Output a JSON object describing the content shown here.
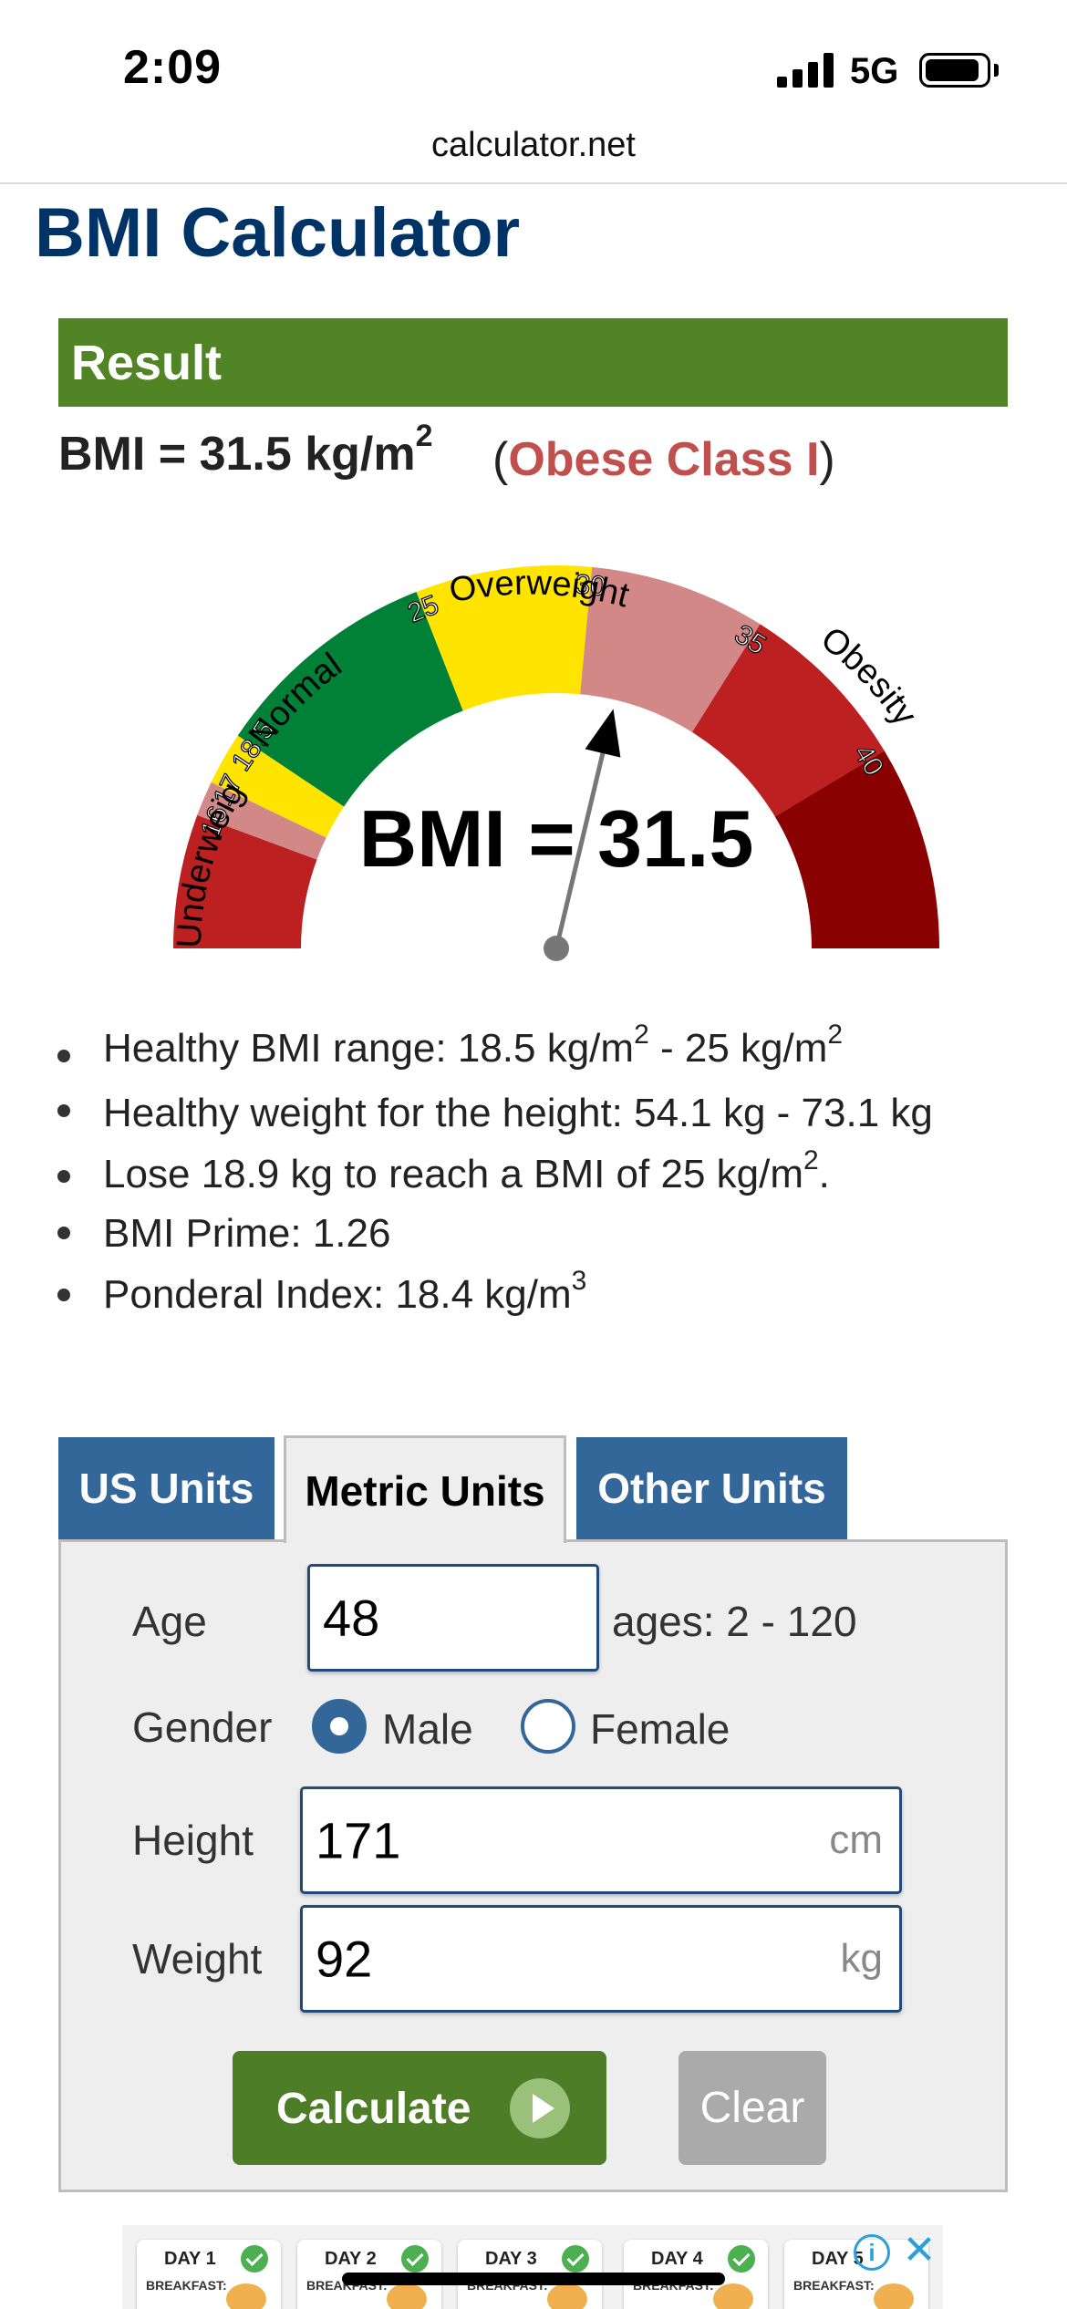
{
  "status_bar": {
    "time": "2:09",
    "network": "5G",
    "battery_level": 0.9
  },
  "browser": {
    "url": "calculator.net"
  },
  "page": {
    "title": "BMI Calculator"
  },
  "result": {
    "heading": "Result",
    "bmi_text": "BMI = 31.5 kg/m",
    "bmi_superscript": "2",
    "open_paren": "(",
    "classification": "Obese Class I",
    "close_paren": ")",
    "class_color": "#c0504d"
  },
  "gauge": {
    "value": 31.5,
    "value_label": "BMI = 31.5",
    "category_labels": [
      "Underweight",
      "Normal",
      "Overweight",
      "Obesity"
    ],
    "tick_labels": [
      "16",
      "17",
      "18.5",
      "25",
      "30",
      "35",
      "40"
    ],
    "colors": {
      "severe_thin": "#bc2020",
      "moderate_thin": "#d38888",
      "mild_thin": "#ffe400",
      "normal": "#008137",
      "overweight": "#ffe400",
      "obese_1": "#d38888",
      "obese_2": "#bc2020",
      "obese_3": "#8a0101"
    }
  },
  "stats": [
    {
      "text": "Healthy BMI range: 18.5 kg/m",
      "sup": "2",
      "text2": " - 25 kg/m",
      "sup2": "2"
    },
    {
      "text": "Healthy weight for the height: 54.1 kg - 73.1 kg"
    },
    {
      "text": "Lose 18.9 kg to reach a BMI of 25 kg/m",
      "sup": "2",
      "text2": "."
    },
    {
      "text": "BMI Prime: 1.26"
    },
    {
      "text": "Ponderal Index: 18.4 kg/m",
      "sup": "3"
    }
  ],
  "tabs": [
    {
      "label": "US Units",
      "active": false
    },
    {
      "label": "Metric Units",
      "active": true
    },
    {
      "label": "Other Units",
      "active": false
    }
  ],
  "form": {
    "age": {
      "label": "Age",
      "value": "48",
      "hint": "ages: 2 - 120"
    },
    "gender": {
      "label": "Gender",
      "options": [
        "Male",
        "Female"
      ],
      "selected": "Male"
    },
    "height": {
      "label": "Height",
      "value": "171",
      "unit": "cm"
    },
    "weight": {
      "label": "Weight",
      "value": "92",
      "unit": "kg"
    },
    "calculate_label": "Calculate",
    "clear_label": "Clear"
  },
  "ad": {
    "days": [
      "DAY 1",
      "DAY 2",
      "DAY 3",
      "DAY 4",
      "DAY 5"
    ],
    "sub": "BREAKFAST:"
  },
  "colors": {
    "title": "#003366",
    "result_bar": "#518425",
    "tab": "#336699",
    "calculate": "#4e7d28",
    "clear": "#aaaaaa"
  }
}
